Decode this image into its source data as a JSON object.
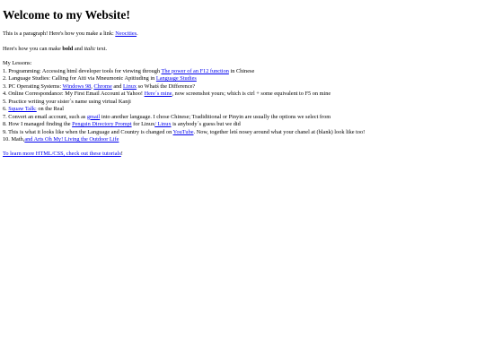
{
  "heading": "Welcome to my Website!",
  "para1": {
    "text_before": "This is a paragraph! Here's how you make a link: ",
    "link_text": "Neocities",
    "text_after": "."
  },
  "para2": {
    "before": "Here's how you can make ",
    "bold": "bold",
    "middle": " and ",
    "italic": "italic",
    "after": " text."
  },
  "lessons": {
    "title": "My Lessons:",
    "items": [
      {
        "pre": "1. Programming: Accessing html developer tools for viewing through ",
        "link": "The power of an F12 function",
        "post": " in Chinese"
      },
      {
        "pre": "2. Language Studies: Calling for Aiti via Mneumonic Apitiuding in ",
        "link": "Language Studies",
        "post": ""
      },
      {
        "pre": "3. PC Operating Systems: ",
        "link1": "Windows 98",
        "mid1": ", ",
        "link2": "Chrome",
        "mid2": " and ",
        "link3": "Linux",
        "post": " so Whatś the Difference?"
      },
      {
        "pre": "4. Online Correspondance: My First Email Account at Yahoo! ",
        "link": "Here´s mine",
        "post": ", now screenshot yours; which is ctrl + some equivalent to F5 on mine"
      },
      {
        "pre": "5. Practice writing your sister´s name using virtual Kanji",
        "link": "",
        "post": ""
      },
      {
        "pre": "6. ",
        "link": "Squaw Talk:",
        "post": " on the Real"
      },
      {
        "pre": "7. Convert an email account, such as ",
        "link": "gmail",
        "post": " into another language. I chose Chinese; Tradiditional or Pinyin are usually the options we select from"
      },
      {
        "pre": "8. How I managed finding the ",
        "link1": "Penguin Directory Prompt",
        "mid1": " for Linux",
        "link2": "/ Linux",
        "post": " is anybody´s guess but we did"
      },
      {
        "pre": "9. This is what it looks like when the Language and Country is changed on ",
        "link": "YouTube",
        "post": ". Now, together letś nosey around what your chanel at (blank) look like too!"
      },
      {
        "pre": "10. Math,",
        "link": "and Arts Oh My! Living the Outdoor Life",
        "post": ""
      }
    ]
  },
  "tutorial": {
    "link": "To learn more HTML/CSS, check out these tutorials",
    "after": "!"
  }
}
